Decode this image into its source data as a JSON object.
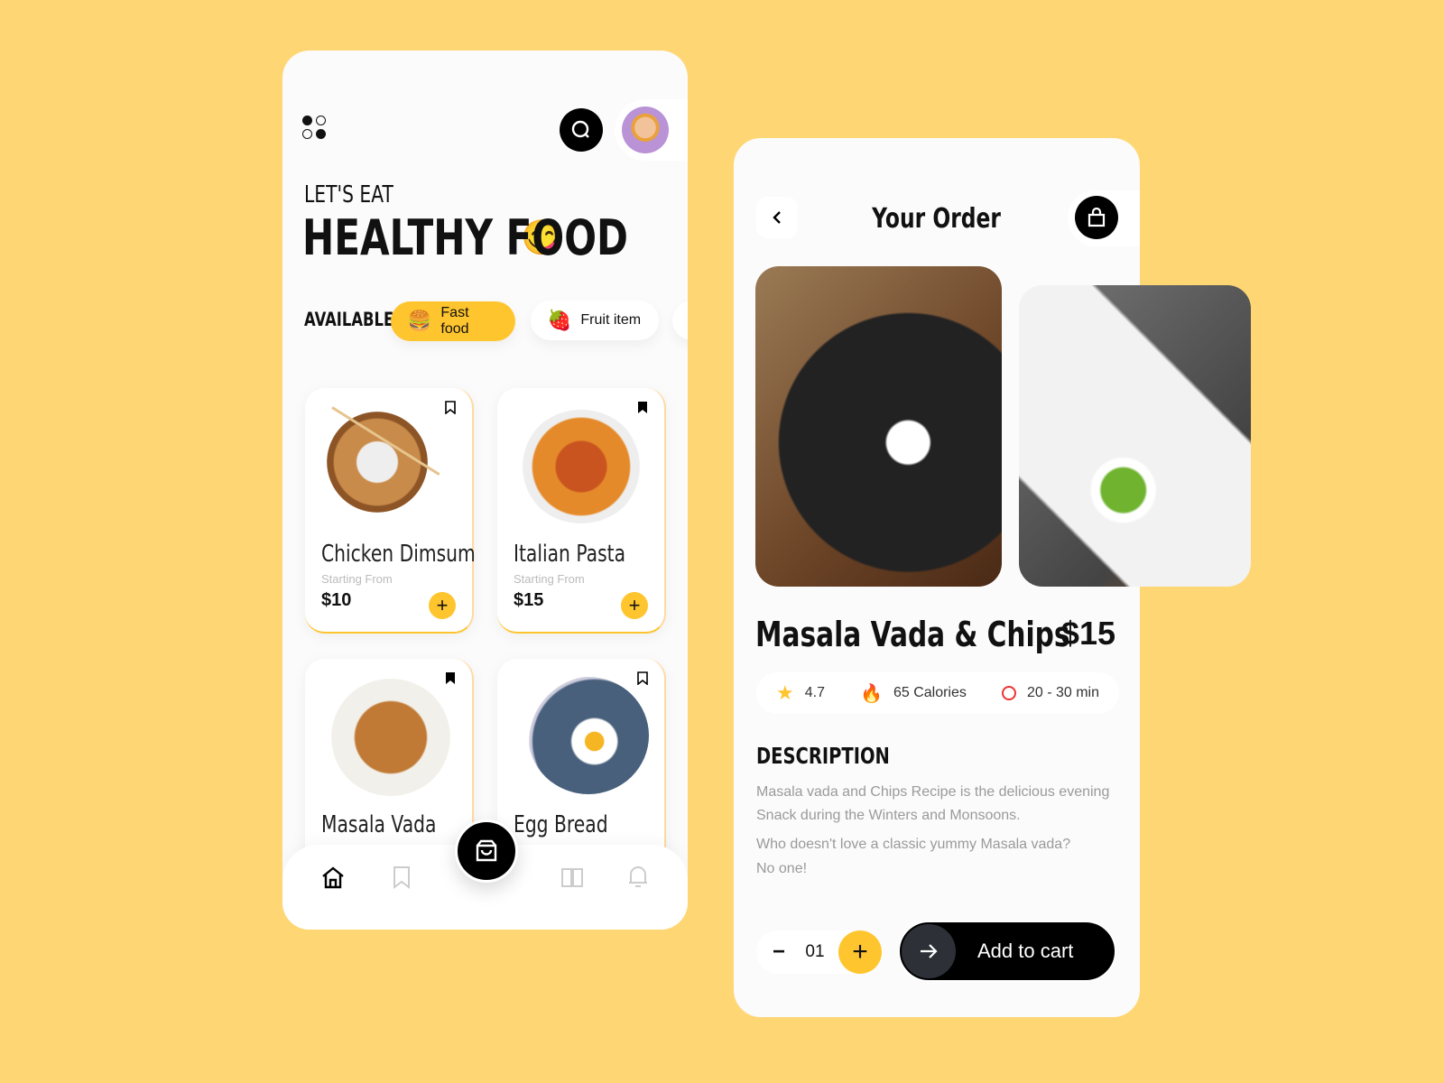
{
  "colors": {
    "background": "#FFD674",
    "accent": "#FFC52E",
    "dark": "#000000"
  },
  "home": {
    "menu_icon": "grid-dots-icon",
    "search_icon": "search-icon",
    "avatar": "user-avatar",
    "eyebrow": "LET'S EAT",
    "title": "HEALTHY FOOD",
    "title_emoji": "😋",
    "available_label": "AVAILABLE",
    "categories": [
      {
        "label": "Fast food",
        "emoji": "🍔",
        "active": true
      },
      {
        "label": "Fruit item",
        "emoji": "🍓",
        "active": false
      }
    ],
    "items": [
      {
        "name": "Chicken Dimsum",
        "sub": "Starting From",
        "price": "$10",
        "bookmarked": false
      },
      {
        "name": "Italian Pasta",
        "sub": "Starting From",
        "price": "$15",
        "bookmarked": true
      },
      {
        "name": "Masala Vada",
        "sub": "",
        "price": "",
        "bookmarked": true
      },
      {
        "name": "Egg Bread",
        "sub": "",
        "price": "",
        "bookmarked": false
      }
    ],
    "nav": [
      "home-icon",
      "bookmark-icon",
      "cart-icon",
      "book-icon",
      "bell-icon"
    ]
  },
  "order": {
    "title": "Your Order",
    "item_name": "Masala Vada & Chips",
    "price": "$15",
    "rating": "4.7",
    "calories": "65 Calories",
    "time": "20 - 30 min",
    "desc_heading": "DESCRIPTION",
    "desc_lines": [
      "Masala vada and Chips Recipe is the delicious evening",
      "Snack during the Winters and Monsoons.",
      "Who doesn't love a classic yummy Masala vada?",
      "No one!"
    ],
    "quantity": "01",
    "minus": "−",
    "plus": "+",
    "add_to_cart": "Add to cart"
  }
}
